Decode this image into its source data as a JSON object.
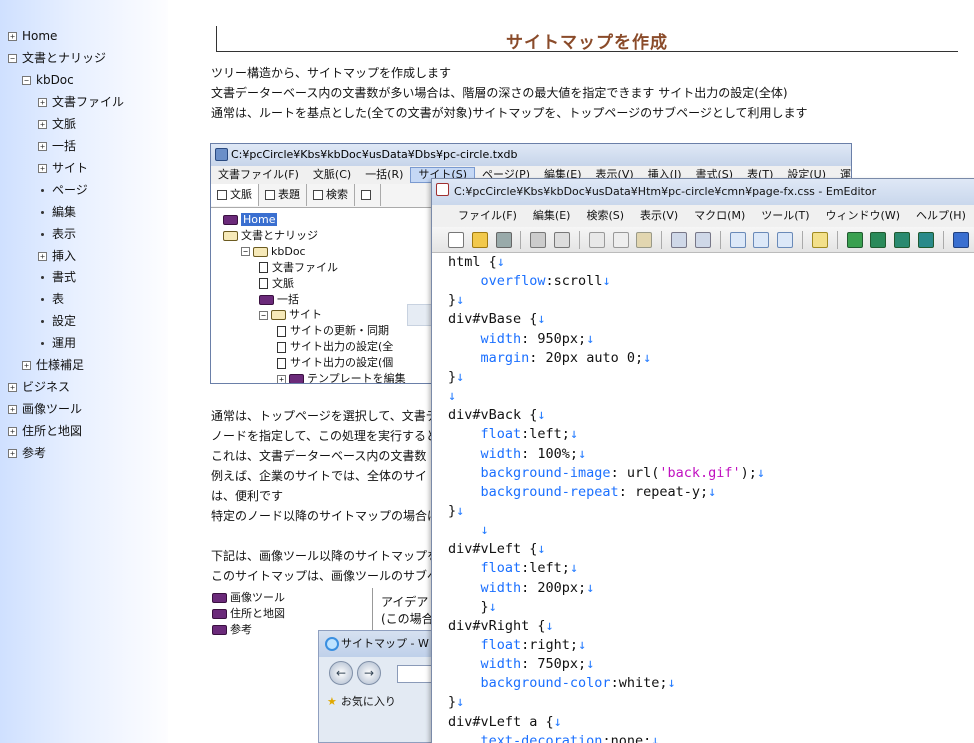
{
  "sidebar": {
    "items": [
      {
        "label": "Home",
        "toggle": "+",
        "level": 0
      },
      {
        "label": "文書とナリッジ",
        "toggle": "−",
        "level": 0
      },
      {
        "label": "kbDoc",
        "toggle": "−",
        "level": 1
      },
      {
        "label": "文書ファイル",
        "toggle": "+",
        "level": 2
      },
      {
        "label": "文脈",
        "toggle": "+",
        "level": 2
      },
      {
        "label": "一括",
        "toggle": "+",
        "level": 2
      },
      {
        "label": "サイト",
        "toggle": "+",
        "level": 2
      },
      {
        "label": "ページ",
        "toggle": "dot",
        "level": 2
      },
      {
        "label": "編集",
        "toggle": "dot",
        "level": 2
      },
      {
        "label": "表示",
        "toggle": "dot",
        "level": 2
      },
      {
        "label": "挿入",
        "toggle": "+",
        "level": 2
      },
      {
        "label": "書式",
        "toggle": "dot",
        "level": 2
      },
      {
        "label": "表",
        "toggle": "dot",
        "level": 2
      },
      {
        "label": "設定",
        "toggle": "dot",
        "level": 2
      },
      {
        "label": "運用",
        "toggle": "dot",
        "level": 2
      },
      {
        "label": "仕様補足",
        "toggle": "+",
        "level": 1
      },
      {
        "label": "ビジネス",
        "toggle": "+",
        "level": 0
      },
      {
        "label": "画像ツール",
        "toggle": "+",
        "level": 0
      },
      {
        "label": "住所と地図",
        "toggle": "+",
        "level": 0
      },
      {
        "label": "参考",
        "toggle": "+",
        "level": 0
      }
    ]
  },
  "main": {
    "title": "サイトマップを作成",
    "intro": [
      "ツリー構造から、サイトマップを作成します",
      "文書データーベース内の文書数が多い場合は、階層の深さの最大値を指定できます  サイト出力の設定(全体)",
      "通常は、ルートを基点とした(全ての文書が対象)サイトマップを、トップページのサブページとして利用します"
    ],
    "body": [
      "通常は、トップページを選択して、文書デ",
      "ノードを指定して、この処理を実行すると技",
      "これは、文書データーベース内の文書数",
      "例えば、企業のサイトでは、全体のサイト",
      "は、便利です",
      "特定のノード以降のサイトマップの場合は",
      "",
      "下記は、画像ツール以降のサイトマップを",
      "このサイトマップは、画像ツールのサブペ"
    ],
    "example_tree": [
      "画像ツール",
      "住所と地図",
      "参考"
    ],
    "example_right": [
      "アイデア",
      "(この場合"
    ]
  },
  "kbdoc_window": {
    "title": "C:¥pcCircle¥Kbs¥kbDoc¥usData¥Dbs¥pc-circle.txdb",
    "menus": [
      "文書ファイル(F)",
      "文脈(C)",
      "一括(R)",
      "サイト(S)",
      "ページ(P)",
      "編集(E)",
      "表示(V)",
      "挿入(I)",
      "書式(S)",
      "表(T)",
      "設定(U)",
      "運用("
    ],
    "tabs": [
      "文脈",
      "表題",
      "検索"
    ],
    "tree": [
      {
        "label": "Home",
        "type": "book",
        "indent": 0,
        "selected": true
      },
      {
        "label": "文書とナリッジ",
        "type": "openbook",
        "indent": 0
      },
      {
        "label": "kbDoc",
        "type": "openbook",
        "indent": 1,
        "toggle": "−"
      },
      {
        "label": "文書ファイル",
        "type": "doc",
        "indent": 2
      },
      {
        "label": "文脈",
        "type": "doc",
        "indent": 2
      },
      {
        "label": "一括",
        "type": "book",
        "indent": 2
      },
      {
        "label": "サイト",
        "type": "openbook",
        "indent": 2,
        "toggle": "−"
      },
      {
        "label": "サイトの更新・同期",
        "type": "doc",
        "indent": 3
      },
      {
        "label": "サイト出力の設定(全",
        "type": "doc",
        "indent": 3
      },
      {
        "label": "サイト出力の設定(個",
        "type": "doc",
        "indent": 3
      },
      {
        "label": "テンプレートを編集",
        "type": "book",
        "indent": 3,
        "toggle": "+"
      }
    ]
  },
  "editor_window": {
    "title": "C:¥pcCircle¥Kbs¥kbDoc¥usData¥Htm¥pc-circle¥cmn¥page-fx.css - EmEditor",
    "menus": [
      "ファイル(F)",
      "編集(E)",
      "検索(S)",
      "表示(V)",
      "マクロ(M)",
      "ツール(T)",
      "ウィンドウ(W)",
      "ヘルプ(H)"
    ],
    "code": [
      [
        {
          "t": "html {",
          "c": ""
        },
        {
          "t": "↓",
          "c": "nl"
        }
      ],
      [
        {
          "t": "    ",
          "c": ""
        },
        {
          "t": "overflow",
          "c": "k"
        },
        {
          "t": ":scroll",
          "c": ""
        },
        {
          "t": "↓",
          "c": "nl"
        }
      ],
      [
        {
          "t": "}",
          "c": ""
        },
        {
          "t": "↓",
          "c": "nl"
        }
      ],
      [
        {
          "t": "div#vBase {",
          "c": ""
        },
        {
          "t": "↓",
          "c": "nl"
        }
      ],
      [
        {
          "t": "    ",
          "c": ""
        },
        {
          "t": "width",
          "c": "k"
        },
        {
          "t": ": 950px;",
          "c": ""
        },
        {
          "t": "↓",
          "c": "nl"
        }
      ],
      [
        {
          "t": "    ",
          "c": ""
        },
        {
          "t": "margin",
          "c": "k"
        },
        {
          "t": ": 20px auto 0;",
          "c": ""
        },
        {
          "t": "↓",
          "c": "nl"
        }
      ],
      [
        {
          "t": "}",
          "c": ""
        },
        {
          "t": "↓",
          "c": "nl"
        }
      ],
      [
        {
          "t": "↓",
          "c": "nl"
        }
      ],
      [
        {
          "t": "div#vBack {",
          "c": ""
        },
        {
          "t": "↓",
          "c": "nl"
        }
      ],
      [
        {
          "t": "    ",
          "c": ""
        },
        {
          "t": "float",
          "c": "k"
        },
        {
          "t": ":left;",
          "c": ""
        },
        {
          "t": "↓",
          "c": "nl"
        }
      ],
      [
        {
          "t": "    ",
          "c": ""
        },
        {
          "t": "width",
          "c": "k"
        },
        {
          "t": ": 100%;",
          "c": ""
        },
        {
          "t": "↓",
          "c": "nl"
        }
      ],
      [
        {
          "t": "    ",
          "c": ""
        },
        {
          "t": "background-image",
          "c": "k"
        },
        {
          "t": ": url(",
          "c": ""
        },
        {
          "t": "'back.gif'",
          "c": "s"
        },
        {
          "t": ");",
          "c": ""
        },
        {
          "t": "↓",
          "c": "nl"
        }
      ],
      [
        {
          "t": "    ",
          "c": ""
        },
        {
          "t": "background-repeat",
          "c": "k"
        },
        {
          "t": ": repeat-y;",
          "c": ""
        },
        {
          "t": "↓",
          "c": "nl"
        }
      ],
      [
        {
          "t": "}",
          "c": ""
        },
        {
          "t": "↓",
          "c": "nl"
        }
      ],
      [
        {
          "t": "    ",
          "c": ""
        },
        {
          "t": "↓",
          "c": "nl"
        }
      ],
      [
        {
          "t": "div#vLeft {",
          "c": ""
        },
        {
          "t": "↓",
          "c": "nl"
        }
      ],
      [
        {
          "t": "    ",
          "c": ""
        },
        {
          "t": "float",
          "c": "k"
        },
        {
          "t": ":left;",
          "c": ""
        },
        {
          "t": "↓",
          "c": "nl"
        }
      ],
      [
        {
          "t": "    ",
          "c": ""
        },
        {
          "t": "width",
          "c": "k"
        },
        {
          "t": ": 200px;",
          "c": ""
        },
        {
          "t": "↓",
          "c": "nl"
        }
      ],
      [
        {
          "t": "    }",
          "c": ""
        },
        {
          "t": "↓",
          "c": "nl"
        }
      ],
      [
        {
          "t": "div#vRight {",
          "c": ""
        },
        {
          "t": "↓",
          "c": "nl"
        }
      ],
      [
        {
          "t": "    ",
          "c": ""
        },
        {
          "t": "float",
          "c": "k"
        },
        {
          "t": ":right;",
          "c": ""
        },
        {
          "t": "↓",
          "c": "nl"
        }
      ],
      [
        {
          "t": "    ",
          "c": ""
        },
        {
          "t": "width",
          "c": "k"
        },
        {
          "t": ": 750px;",
          "c": ""
        },
        {
          "t": "↓",
          "c": "nl"
        }
      ],
      [
        {
          "t": "    ",
          "c": ""
        },
        {
          "t": "background-color",
          "c": "k"
        },
        {
          "t": ":white;",
          "c": ""
        },
        {
          "t": "↓",
          "c": "nl"
        }
      ],
      [
        {
          "t": "}",
          "c": ""
        },
        {
          "t": "↓",
          "c": "nl"
        }
      ],
      [
        {
          "t": "div#vLeft a {",
          "c": ""
        },
        {
          "t": "↓",
          "c": "nl"
        }
      ],
      [
        {
          "t": "    ",
          "c": ""
        },
        {
          "t": "text-decoration",
          "c": "k"
        },
        {
          "t": ":none;",
          "c": ""
        },
        {
          "t": "↓",
          "c": "nl"
        }
      ]
    ]
  },
  "browser_window": {
    "title": "サイトマップ - W",
    "favorites": "お気に入り"
  },
  "colors": {
    "title": "#8a4b2a",
    "keyword": "#1a6fff",
    "string": "#c010c0",
    "selection": "#3a6fd0"
  }
}
